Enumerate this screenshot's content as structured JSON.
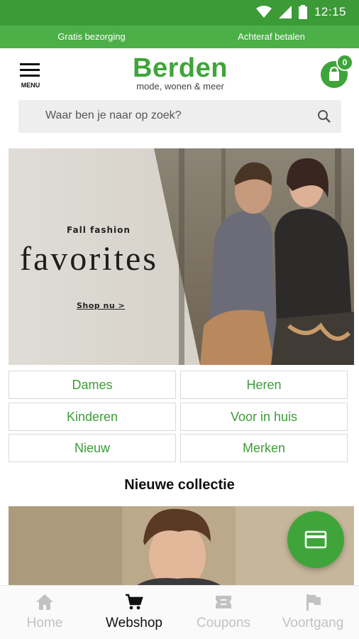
{
  "status_bar": {
    "time": "12:15"
  },
  "promo": {
    "left": "Gratis bezorging",
    "right": "Achteraf betalen"
  },
  "header": {
    "menu_label": "MENU",
    "logo_word": "Berden",
    "logo_tagline": "mode, wonen & meer",
    "cart_count": "0"
  },
  "search": {
    "placeholder": "Waar ben je naar op zoek?"
  },
  "hero": {
    "kicker": "Fall fashion",
    "headline": "favorites",
    "cta": "Shop nu >"
  },
  "categories": [
    {
      "label": "Dames"
    },
    {
      "label": "Heren"
    },
    {
      "label": "Kinderen"
    },
    {
      "label": "Voor in huis"
    },
    {
      "label": "Nieuw"
    },
    {
      "label": "Merken"
    }
  ],
  "section": {
    "title": "Nieuwe collectie"
  },
  "bottom_nav": [
    {
      "label": "Home",
      "icon": "home-icon",
      "active": false
    },
    {
      "label": "Webshop",
      "icon": "cart-icon",
      "active": true
    },
    {
      "label": "Coupons",
      "icon": "ticket-icon",
      "active": false
    },
    {
      "label": "Voortgang",
      "icon": "flag-icon",
      "active": false
    }
  ],
  "colors": {
    "brand": "#3fa53a",
    "status_bar": "#3c9a37",
    "promo_bar": "#4caf48"
  }
}
